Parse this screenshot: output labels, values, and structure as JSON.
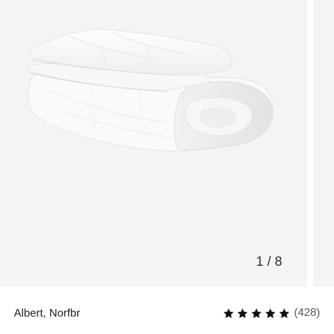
{
  "gallery": {
    "current": "1",
    "separator": "/",
    "total": "8",
    "image_subject": "folded white duvet"
  },
  "product": {
    "seller": "Albert, Norfbr",
    "rating": 5,
    "rating_max": 5,
    "review_count": "(428)"
  },
  "icons": {
    "star": "star-icon"
  },
  "colors": {
    "star": "#111111",
    "image_bg": "#f4f4f4"
  }
}
